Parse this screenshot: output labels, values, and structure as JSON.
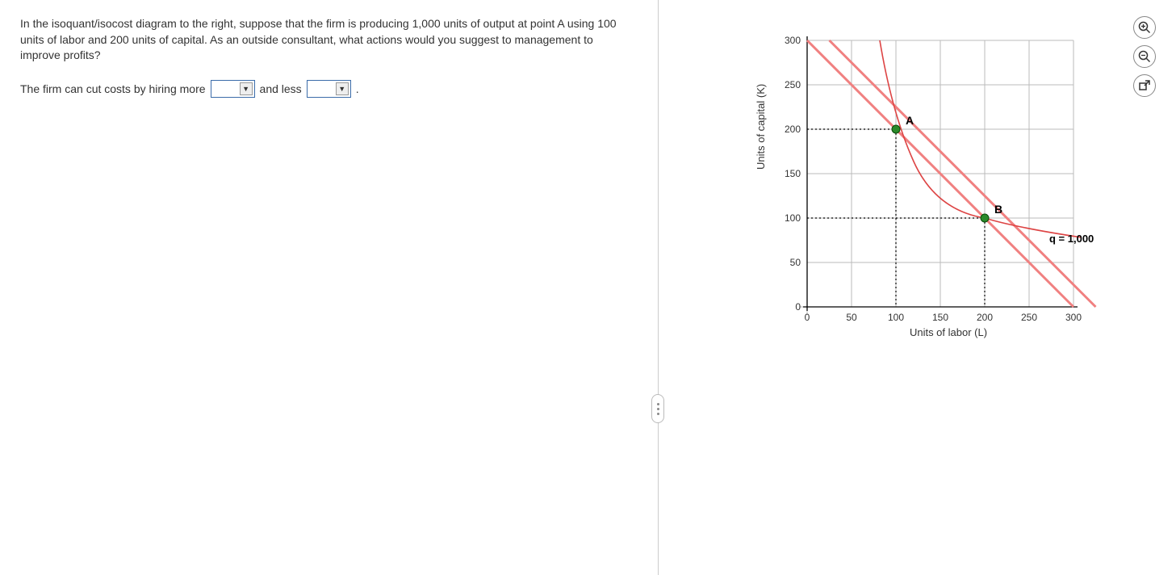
{
  "question": {
    "paragraph": "In the isoquant/isocost diagram to the right, suppose that the firm is producing 1,000 units of output at point A using 100 units of labor and 200 units of capital. As an outside consultant, what actions would you suggest to management to improve profits?",
    "answer_prefix": "The firm can cut costs by hiring more",
    "answer_mid": "and less",
    "answer_suffix": "."
  },
  "chart_data": {
    "type": "line",
    "title": "",
    "xlabel": "Units of labor (L)",
    "ylabel": "Units of capital (K)",
    "xlim": [
      0,
      300
    ],
    "ylim": [
      0,
      300
    ],
    "xticks": [
      0,
      50,
      100,
      150,
      200,
      250,
      300
    ],
    "yticks": [
      0,
      50,
      100,
      150,
      200,
      250,
      300
    ],
    "series": [
      {
        "name": "isocost_A",
        "type": "line",
        "points": [
          [
            0,
            300
          ],
          [
            300,
            0
          ]
        ]
      },
      {
        "name": "isocost_B",
        "type": "line",
        "points": [
          [
            25,
            300
          ],
          [
            325,
            0
          ]
        ]
      },
      {
        "name": "isoquant_q1000",
        "type": "curve",
        "points_estimated": [
          [
            80,
            300
          ],
          [
            90,
            240
          ],
          [
            100,
            200
          ],
          [
            130,
            150
          ],
          [
            160,
            120
          ],
          [
            200,
            100
          ],
          [
            250,
            85
          ],
          [
            300,
            78
          ]
        ]
      }
    ],
    "points": [
      {
        "name": "A",
        "x": 100,
        "y": 200
      },
      {
        "name": "B",
        "x": 200,
        "y": 100
      }
    ],
    "annotations": [
      {
        "text": "q = 1,000",
        "x": 308,
        "y": 78
      }
    ]
  },
  "labels": {
    "point_A": "A",
    "point_B": "B",
    "curve_q": "q = 1,000"
  },
  "controls": {
    "zoom_in": "zoom-in",
    "zoom_out": "zoom-out",
    "expand": "expand"
  }
}
